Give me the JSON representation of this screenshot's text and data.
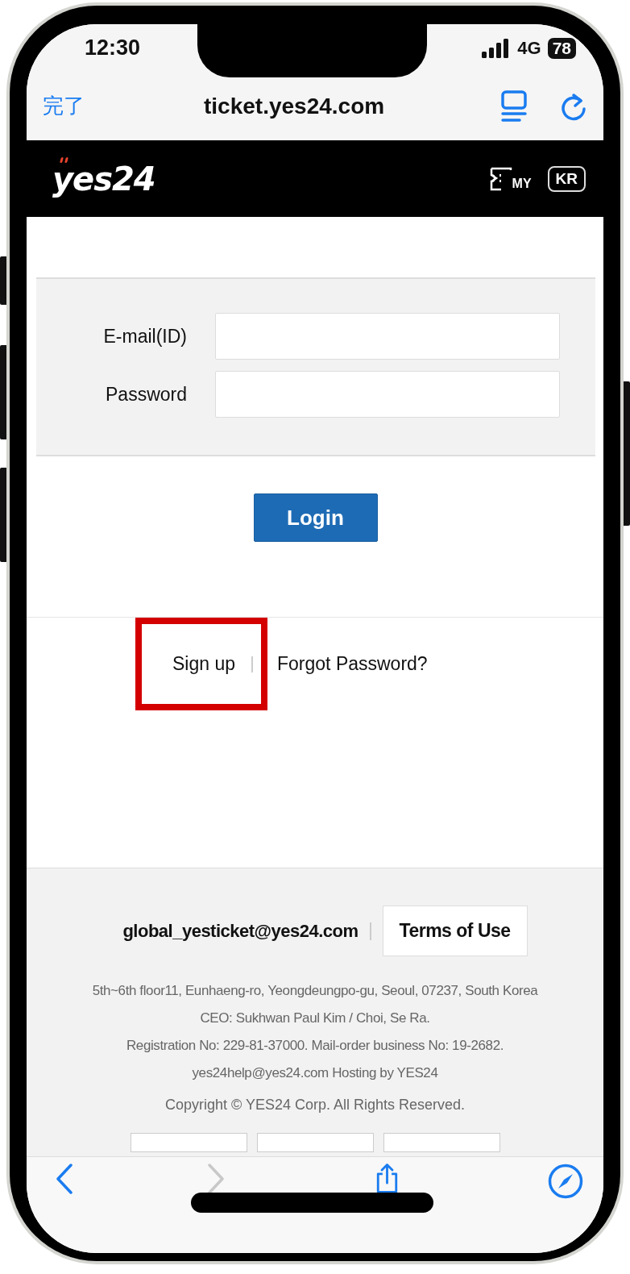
{
  "status_bar": {
    "time": "12:30",
    "network": "4G",
    "battery": "78"
  },
  "browser": {
    "done": "完了",
    "url": "ticket.yes24.com"
  },
  "header": {
    "logo": "yes24",
    "my": "MY",
    "language": "KR"
  },
  "login_form": {
    "fields": [
      {
        "label": "E-mail(ID)"
      },
      {
        "label": "Password"
      }
    ],
    "button": "Login"
  },
  "links": [
    {
      "label": "Sign up",
      "highlighted": true
    },
    {
      "label": "Forgot Password?",
      "highlighted": false
    }
  ],
  "footer": {
    "email": "global_yesticket@yes24.com",
    "terms": "Terms of Use",
    "address_lines": [
      "5th~6th floor11, Eunhaeng-ro, Yeongdeungpo-gu, Seoul, 07237, South Korea",
      "CEO: Sukhwan Paul Kim / Choi, Se Ra.",
      "Registration No: 229-81-37000. Mail-order business No: 19-2682.",
      "yes24help@yes24.com Hosting by YES24"
    ],
    "copyright": "Copyright © YES24 Corp. All Rights Reserved."
  }
}
